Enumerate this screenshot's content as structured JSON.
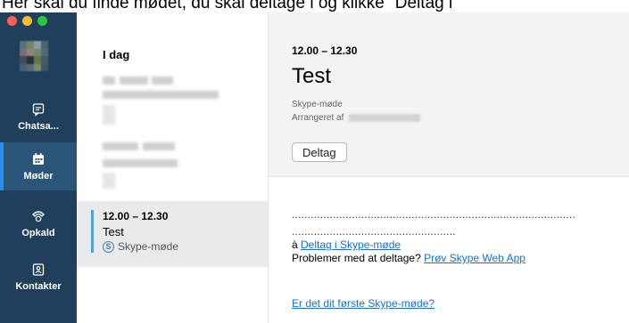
{
  "caption": "Her skal du finde mødet, du skal deltage i og klikke \"Deltag i",
  "sidebar": {
    "items": [
      {
        "label": "Chatsa...",
        "icon": "chat-icon"
      },
      {
        "label": "Møder",
        "icon": "calendar-icon"
      },
      {
        "label": "Opkald",
        "icon": "phone-icon"
      },
      {
        "label": "Kontakter",
        "icon": "contacts-icon"
      }
    ],
    "active": "Møder"
  },
  "list": {
    "heading": "I dag",
    "event": {
      "time": "12.00 – 12.30",
      "title": "Test",
      "type": "Skype-møde"
    }
  },
  "detail": {
    "time": "12.00 – 12.30",
    "title": "Test",
    "subtitle": "Skype-møde",
    "organizer_label": "Arrangeret af",
    "join_button": "Deltag",
    "dots1": "..........................................................................................",
    "dots2": "....................................................",
    "join_prefix": "à ",
    "join_link": "Deltag i Skype-møde",
    "problem_text": "Problemer med at deltage? ",
    "webapp_link": "Prøv Skype Web App",
    "first_link": "Er det dit første Skype-møde?"
  },
  "colors": {
    "sidebar_bg": "#1f3f5c",
    "sidebar_active": "#2a5478",
    "accent": "#2d8cf0",
    "link": "#1a6fd1"
  }
}
